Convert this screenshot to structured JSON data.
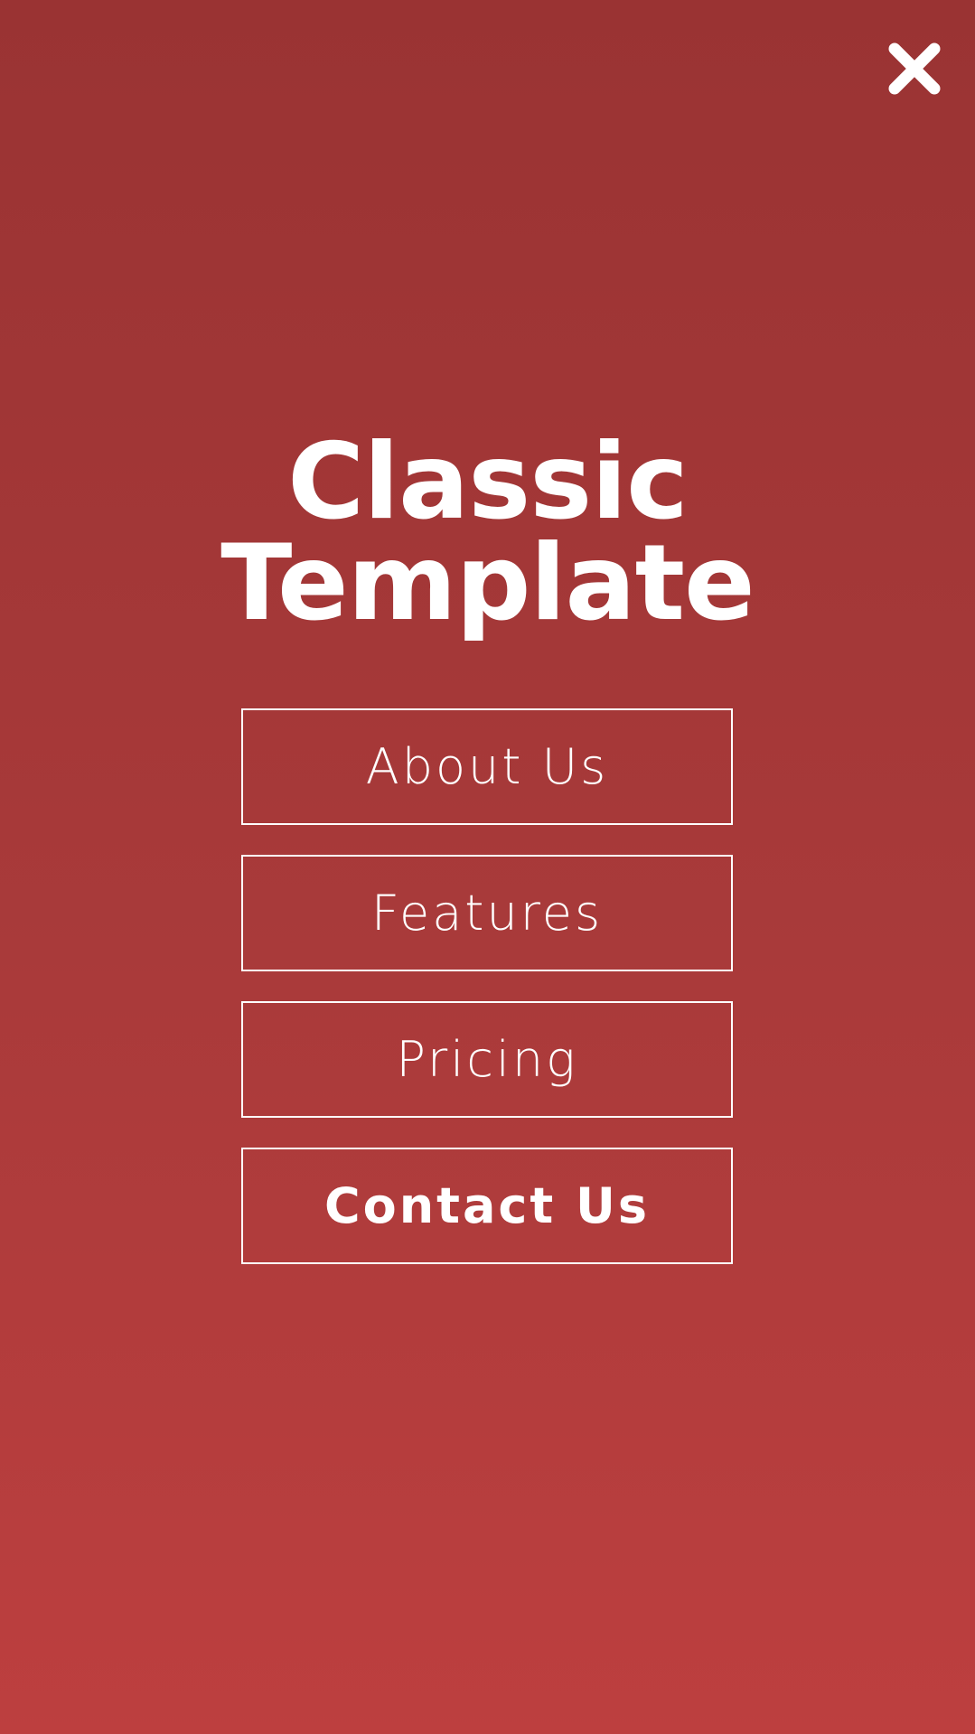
{
  "header": {
    "close_icon": "close-icon"
  },
  "title": {
    "line1": "Classic",
    "line2": "Template"
  },
  "menu": {
    "items": [
      {
        "label": "About Us"
      },
      {
        "label": "Features"
      },
      {
        "label": "Pricing"
      },
      {
        "label": "Contact Us"
      }
    ]
  },
  "colors": {
    "background_top": "#9a3333",
    "background_bottom": "#bd3f3f",
    "foreground": "#ffffff"
  }
}
